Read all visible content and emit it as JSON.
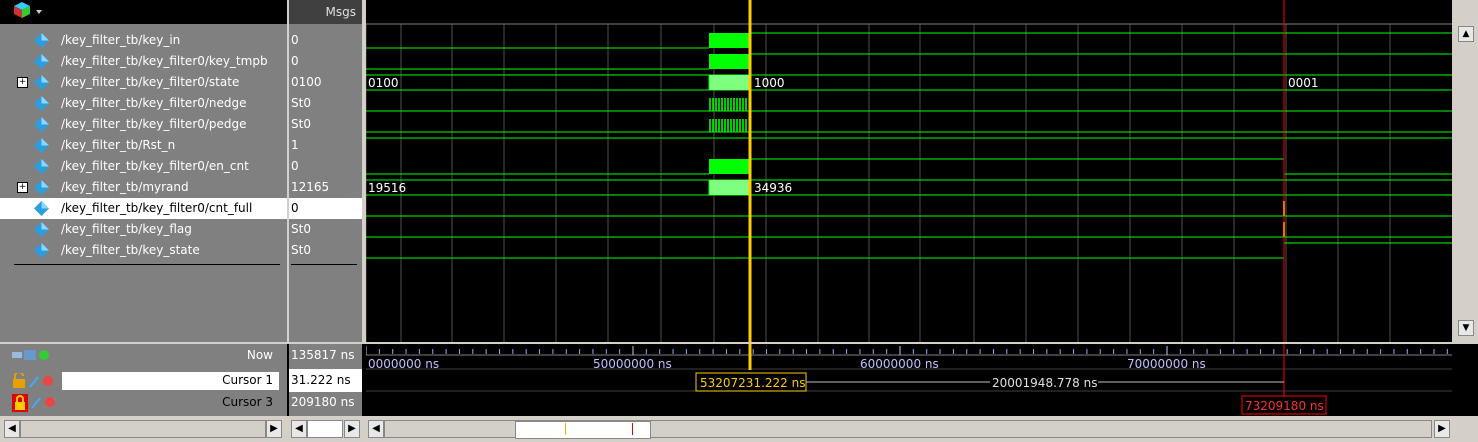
{
  "header": {
    "msgs_label": "Msgs"
  },
  "signals": [
    {
      "name": "/key_filter_tb/key_in",
      "value": "0",
      "expandable": false
    },
    {
      "name": "/key_filter_tb/key_filter0/key_tmpb",
      "value": "0",
      "expandable": false
    },
    {
      "name": "/key_filter_tb/key_filter0/state",
      "value": "0100",
      "expandable": true
    },
    {
      "name": "/key_filter_tb/key_filter0/nedge",
      "value": "St0",
      "expandable": false
    },
    {
      "name": "/key_filter_tb/key_filter0/pedge",
      "value": "St0",
      "expandable": false
    },
    {
      "name": "/key_filter_tb/Rst_n",
      "value": "1",
      "expandable": false
    },
    {
      "name": "/key_filter_tb/key_filter0/en_cnt",
      "value": "0",
      "expandable": false
    },
    {
      "name": "/key_filter_tb/myrand",
      "value": "12165",
      "expandable": true
    },
    {
      "name": "/key_filter_tb/key_filter0/cnt_full",
      "value": "0",
      "expandable": false,
      "selected": true
    },
    {
      "name": "/key_filter_tb/key_flag",
      "value": "St0",
      "expandable": false
    },
    {
      "name": "/key_filter_tb/key_state",
      "value": "St0",
      "expandable": false
    }
  ],
  "bus_labels": {
    "state_before": "0100",
    "state_mid": "1000",
    "state_after": "0001",
    "myrand_before": "19516",
    "myrand_after": "34936"
  },
  "timeline": {
    "now_label": "Now",
    "now_value": "135817 ns",
    "cursor1_label": "Cursor 1",
    "cursor1_value": "31.222 ns",
    "cursor3_label": "Cursor 3",
    "cursor3_value": "209180 ns",
    "ticks": [
      "0000000 ns",
      "50000000 ns",
      "60000000 ns",
      "70000000 ns"
    ],
    "cursor1_time": "53207231.222 ns",
    "delta": "20001948.778 ns",
    "cursor3_time": "73209180 ns"
  },
  "colors": {
    "wave": "#00ff00",
    "cursor1": "#ffcc00",
    "cursor3": "#ff0000",
    "grid": "#505050"
  }
}
